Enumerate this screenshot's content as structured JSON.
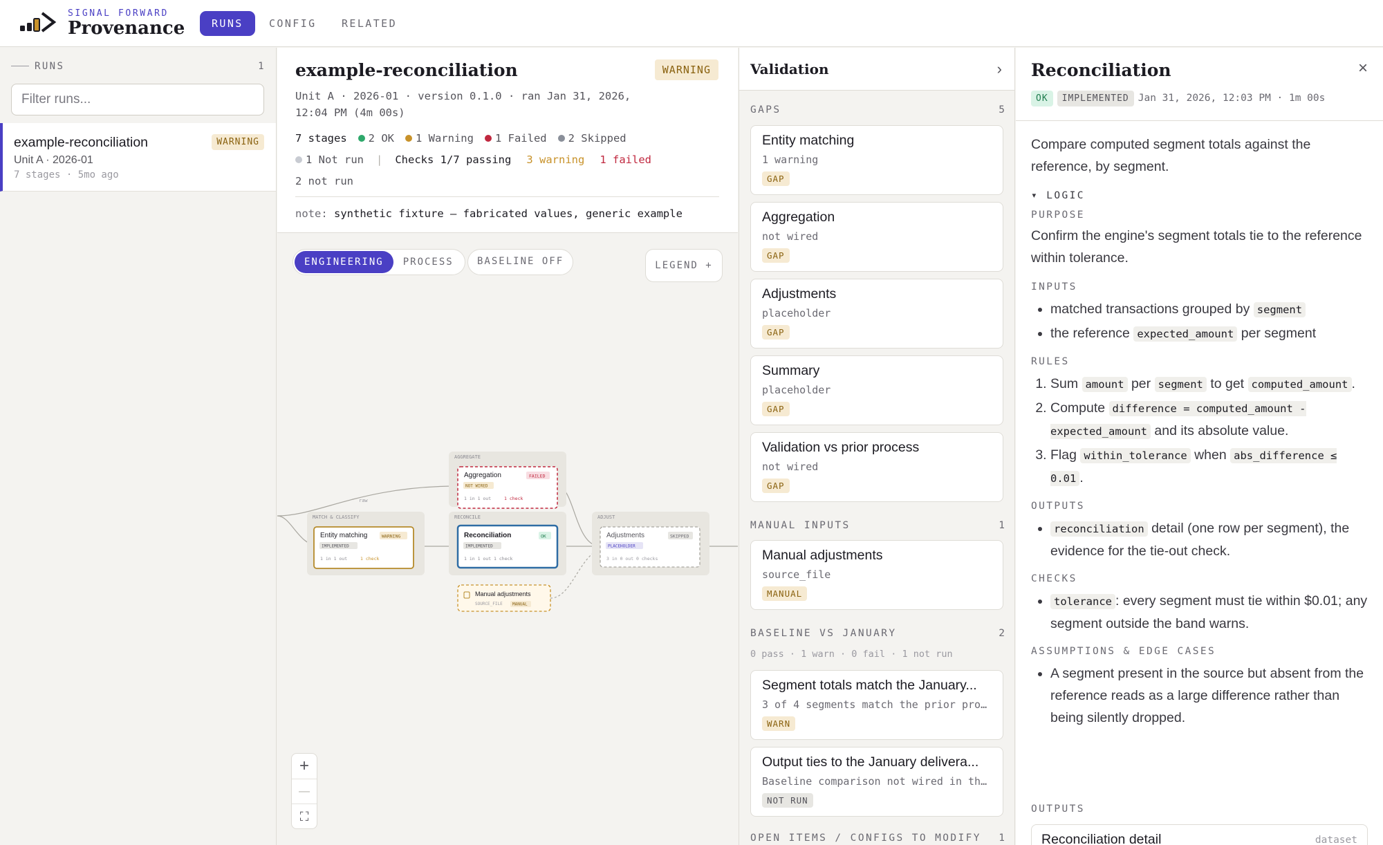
{
  "brand": {
    "subtitle": "SIGNAL FORWARD",
    "title": "Provenance"
  },
  "nav": {
    "tabs": [
      {
        "label": "RUNS",
        "active": true
      },
      {
        "label": "CONFIG",
        "active": false
      },
      {
        "label": "RELATED",
        "active": false
      }
    ]
  },
  "sidebar": {
    "heading": "RUNS",
    "count": "1",
    "filter_placeholder": "Filter runs...",
    "runs": [
      {
        "name": "example-reconciliation",
        "badge": "WARNING",
        "subtitle": "Unit A · 2026-01",
        "meta": "7 stages · 5mo ago"
      }
    ]
  },
  "run": {
    "title": "example-reconciliation",
    "status": "WARNING",
    "meta": "Unit A · 2026-01 · version 0.1.0 · ran Jan 31, 2026, 12:04 PM (4m 00s)",
    "stages": "7 stages",
    "ok": "2 OK",
    "warning": "1 Warning",
    "failed": "1 Failed",
    "skipped": "2 Skipped",
    "not_run": "1 Not run",
    "sep": "|",
    "checks": "Checks 1/7 passing",
    "checks_warning": "3 warning",
    "checks_failed": "1 failed",
    "checks_not_run": "2 not run",
    "note_label": "note:",
    "note_text": "synthetic fixture — fabricated values, generic example"
  },
  "canvas": {
    "view_tabs": [
      {
        "label": "ENGINEERING",
        "active": true
      },
      {
        "label": "PROCESS",
        "active": false
      }
    ],
    "baseline": "BASELINE OFF",
    "legend": "LEGEND  +",
    "zoom_in": "+",
    "zoom_out": "—",
    "fit": "⛶",
    "edge_label": "raw",
    "groups": {
      "aggregate": "AGGREGATE",
      "match": "MATCH & CLASSIFY",
      "reconcile": "RECONCILE",
      "adjust": "ADJUST"
    },
    "nodes": {
      "aggregation": {
        "title": "Aggregation",
        "status": "FAILED",
        "tag": "NOT WIRED",
        "io": "1 in  1 out",
        "check": "1 check"
      },
      "entity": {
        "title": "Entity matching",
        "status": "WARNING",
        "tag": "IMPLEMENTED",
        "io": "1 in  1 out",
        "check": "1 check"
      },
      "recon": {
        "title": "Reconciliation",
        "status": "OK",
        "tag": "IMPLEMENTED",
        "io": "1 in  1 out  1 check"
      },
      "adjust": {
        "title": "Adjustments",
        "status": "SKIPPED",
        "tag": "PLACEHOLDER",
        "io": "3 in  0 out  0 checks"
      },
      "manual": {
        "title": "Manual adjustments",
        "tag1": "SOURCE_FILE",
        "tag2": "MANUAL"
      }
    }
  },
  "validation": {
    "title": "Validation",
    "chevron": "›",
    "gaps": {
      "label": "GAPS",
      "count": "5",
      "items": [
        {
          "title": "Entity matching",
          "sub": "1 warning",
          "badge": "GAP"
        },
        {
          "title": "Aggregation",
          "sub": "not wired",
          "badge": "GAP"
        },
        {
          "title": "Adjustments",
          "sub": "placeholder",
          "badge": "GAP"
        },
        {
          "title": "Summary",
          "sub": "placeholder",
          "badge": "GAP"
        },
        {
          "title": "Validation vs prior process",
          "sub": "not wired",
          "badge": "GAP"
        }
      ]
    },
    "manual": {
      "label": "MANUAL INPUTS",
      "count": "1",
      "items": [
        {
          "title": "Manual adjustments",
          "sub": "source_file",
          "badge": "MANUAL"
        }
      ]
    },
    "baseline": {
      "label": "BASELINE VS JANUARY",
      "count": "2",
      "summary": "0 pass · 1 warn · 0 fail · 1 not run",
      "items": [
        {
          "title": "Segment totals match the January...",
          "sub": "3 of 4 segments match the prior pro...",
          "badge": "WARN"
        },
        {
          "title": "Output ties to the January delivera...",
          "sub": "Baseline comparison not wired in th...",
          "badge": "NOT RUN"
        }
      ]
    },
    "open": {
      "label": "OPEN ITEMS / CONFIGS TO MODIFY",
      "count": "1"
    }
  },
  "detail": {
    "title": "Reconciliation",
    "close": "×",
    "status": "OK",
    "tag": "IMPLEMENTED",
    "timestamp": "Jan 31, 2026, 12:03 PM · 1m 00s",
    "description": "Compare computed segment totals against the reference, by segment.",
    "logic_label": "▾ LOGIC",
    "purpose_label": "PURPOSE",
    "purpose": "Confirm the engine's segment totals tie to the reference within tolerance.",
    "inputs_label": "INPUTS",
    "input1_text": "matched transactions grouped by",
    "input1_code": "segment",
    "input2_pre": "the reference",
    "input2_code": "expected_amount",
    "input2_post": "per segment",
    "rules_label": "RULES",
    "rule1_a": "Sum",
    "rule1_c1": "amount",
    "rule1_b": "per",
    "rule1_c2": "segment",
    "rule1_d": "to get",
    "rule1_c3": "computed_amount",
    "rule1_e": ".",
    "rule2_a": "Compute",
    "rule2_c1": "difference = computed_amount - expected_amount",
    "rule2_b": "and its absolute value.",
    "rule3_a": "Flag",
    "rule3_c1": "within_tolerance",
    "rule3_b": "when",
    "rule3_c2": "abs_difference ≤ 0.01",
    "rule3_e": ".",
    "outputs_label": "OUTPUTS",
    "output_code": "reconciliation",
    "output_text": "detail (one row per segment), the evidence for the tie-out check.",
    "checks_label": "CHECKS",
    "check_code": "tolerance",
    "check_text": ": every segment must tie within $0.01; any segment outside the band warns.",
    "assumptions_label": "ASSUMPTIONS & EDGE CASES",
    "assumption": "A segment present in the source but absent from the reference reads as a large difference rather than being silently dropped.",
    "outputs2_label": "OUTPUTS",
    "output_card_title": "Reconciliation detail",
    "output_card_kind": "dataset"
  },
  "colors": {
    "accent": "#4a3fc4",
    "ok": "#2ea86b",
    "warning": "#c8922a",
    "failed": "#c0283f",
    "skipped": "#8a8f99",
    "not_run": "#c8cbd2"
  }
}
